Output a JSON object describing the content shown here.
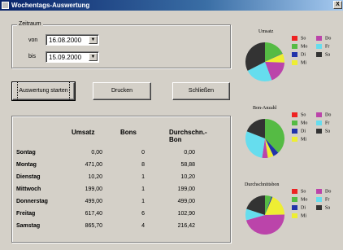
{
  "window": {
    "title": "Wochentags-Auswertung",
    "close_label": "X"
  },
  "zeitraum": {
    "legend": "Zeitraum",
    "von_label": "von",
    "von_value": "16.08.2000",
    "bis_label": "bis",
    "bis_value": "15.09.2000"
  },
  "buttons": {
    "auswertung": "Auswertung starten",
    "drucken": "Drucken",
    "schliessen": "Schließen"
  },
  "table": {
    "headers": [
      "",
      "Umsatz",
      "Bons",
      "Durchschn.-Bon"
    ],
    "rows": [
      {
        "day": "Sontag",
        "umsatz": "0,00",
        "bons": "0",
        "avg": "0,00"
      },
      {
        "day": "Montag",
        "umsatz": "471,00",
        "bons": "8",
        "avg": "58,88"
      },
      {
        "day": "Dienstag",
        "umsatz": "10,20",
        "bons": "1",
        "avg": "10,20"
      },
      {
        "day": "Mittwoch",
        "umsatz": "199,00",
        "bons": "1",
        "avg": "199,00"
      },
      {
        "day": "Donnerstag",
        "umsatz": "499,00",
        "bons": "1",
        "avg": "499,00"
      },
      {
        "day": "Freitag",
        "umsatz": "617,40",
        "bons": "6",
        "avg": "102,90"
      },
      {
        "day": "Samstag",
        "umsatz": "865,70",
        "bons": "4",
        "avg": "216,42"
      }
    ]
  },
  "legend_colors": {
    "So": "#ee2222",
    "Mo": "#55bb44",
    "Di": "#2233aa",
    "Mi": "#eeee33",
    "Do": "#bb44aa",
    "Fr": "#66ddee",
    "Sa": "#333333"
  },
  "legend_labels": {
    "So": "So",
    "Mo": "Mo",
    "Di": "Di",
    "Mi": "Mi",
    "Do": "Do",
    "Fr": "Fr",
    "Sa": "Sa"
  },
  "charts": [
    {
      "title": "Umsatz",
      "slices": [
        {
          "key": "Mo",
          "value": 471.0
        },
        {
          "key": "Di",
          "value": 10.2
        },
        {
          "key": "Mi",
          "value": 199.0
        },
        {
          "key": "Do",
          "value": 499.0
        },
        {
          "key": "Fr",
          "value": 617.4
        },
        {
          "key": "Sa",
          "value": 865.7
        }
      ]
    },
    {
      "title": "Bon-Anzahl",
      "slices": [
        {
          "key": "Mo",
          "value": 8
        },
        {
          "key": "Di",
          "value": 1
        },
        {
          "key": "Mi",
          "value": 1
        },
        {
          "key": "Do",
          "value": 1
        },
        {
          "key": "Fr",
          "value": 6
        },
        {
          "key": "Sa",
          "value": 4
        }
      ]
    },
    {
      "title": "Durchschnittsbon",
      "slices": [
        {
          "key": "Mo",
          "value": 58.88
        },
        {
          "key": "Di",
          "value": 10.2
        },
        {
          "key": "Mi",
          "value": 199.0
        },
        {
          "key": "Do",
          "value": 499.0
        },
        {
          "key": "Fr",
          "value": 102.9
        },
        {
          "key": "Sa",
          "value": 216.42
        }
      ]
    }
  ]
}
